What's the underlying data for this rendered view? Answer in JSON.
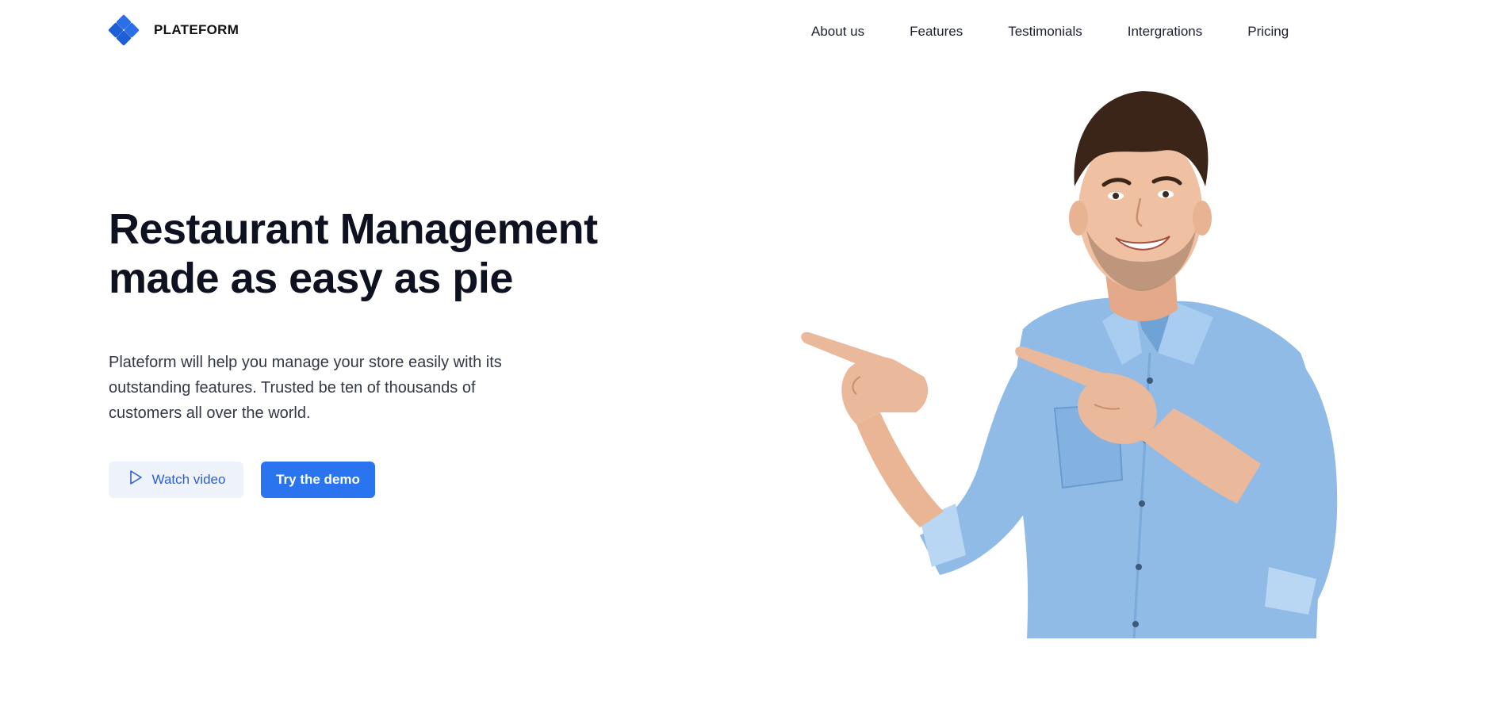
{
  "brand": {
    "name": "PLATEFORM",
    "logo_icon": "diamond-cluster-icon",
    "accent_color": "#2a74f0"
  },
  "nav": {
    "items": [
      {
        "label": "About us"
      },
      {
        "label": "Features"
      },
      {
        "label": "Testimonials"
      },
      {
        "label": "Intergrations"
      },
      {
        "label": "Pricing"
      }
    ]
  },
  "hero": {
    "title_line1": "Restaurant Management",
    "title_line2": "made as easy as pie",
    "description": "Plateform will help you manage your store easily with its outstanding features. Trusted be ten of thousands of customers all over the world.",
    "watch_video_label": "Watch video",
    "watch_video_icon": "play-icon",
    "try_demo_label": "Try the demo",
    "image": "man-pointing-photo"
  }
}
